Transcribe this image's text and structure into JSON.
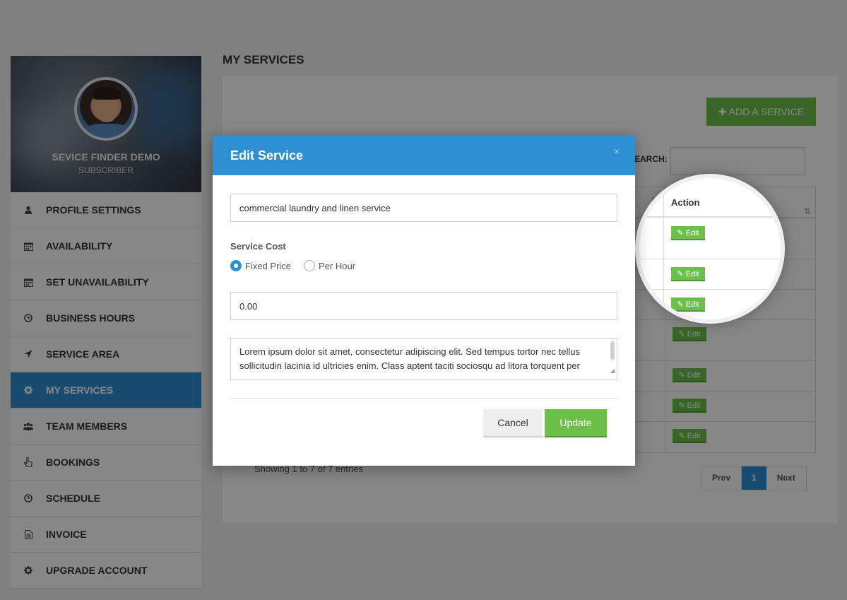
{
  "profile": {
    "name": "SEVICE FINDER DEMO",
    "role": "SUBSCRIBER"
  },
  "sidebar": {
    "items": [
      {
        "label": "PROFILE SETTINGS",
        "icon": "user-icon"
      },
      {
        "label": "AVAILABILITY",
        "icon": "calendar-icon"
      },
      {
        "label": "SET UNAVAILABILITY",
        "icon": "calendar-icon"
      },
      {
        "label": "BUSINESS HOURS",
        "icon": "clock-icon"
      },
      {
        "label": "SERVICE AREA",
        "icon": "location-arrow-icon"
      },
      {
        "label": "MY SERVICES",
        "icon": "gear-icon",
        "active": true
      },
      {
        "label": "TEAM MEMBERS",
        "icon": "users-icon"
      },
      {
        "label": "BOOKINGS",
        "icon": "hand-pointer-icon"
      },
      {
        "label": "SCHEDULE",
        "icon": "clock-icon"
      },
      {
        "label": "INVOICE",
        "icon": "document-icon"
      },
      {
        "label": "UPGRADE ACCOUNT",
        "icon": "gear-icon"
      }
    ]
  },
  "main": {
    "title": "MY SERVICES",
    "add_button": "✚ ADD A SERVICE",
    "search_label": "SEARCH:",
    "table": {
      "action_header": "Action",
      "edit_label": "✎ Edit"
    },
    "showing": "Showing 1 to 7 of 7 entries",
    "pager": {
      "prev": "Prev",
      "current": "1",
      "next": "Next"
    }
  },
  "modal": {
    "title": "Edit Service",
    "close": "×",
    "service_name": "commercial laundry and linen service",
    "cost_label": "Service Cost",
    "radio_fixed": "Fixed Price",
    "radio_hour": "Per Hour",
    "price": "0.00",
    "description": "Lorem ipsum dolor sit amet, consectetur adipiscing elit. Sed tempus tortor nec tellus sollicitudin lacinia id ultricies enim. Class aptent taciti sociosqu ad litora torquent per",
    "cancel": "Cancel",
    "update": "Update"
  },
  "colors": {
    "accent": "#2f8fd3",
    "success": "#6cc04a"
  }
}
